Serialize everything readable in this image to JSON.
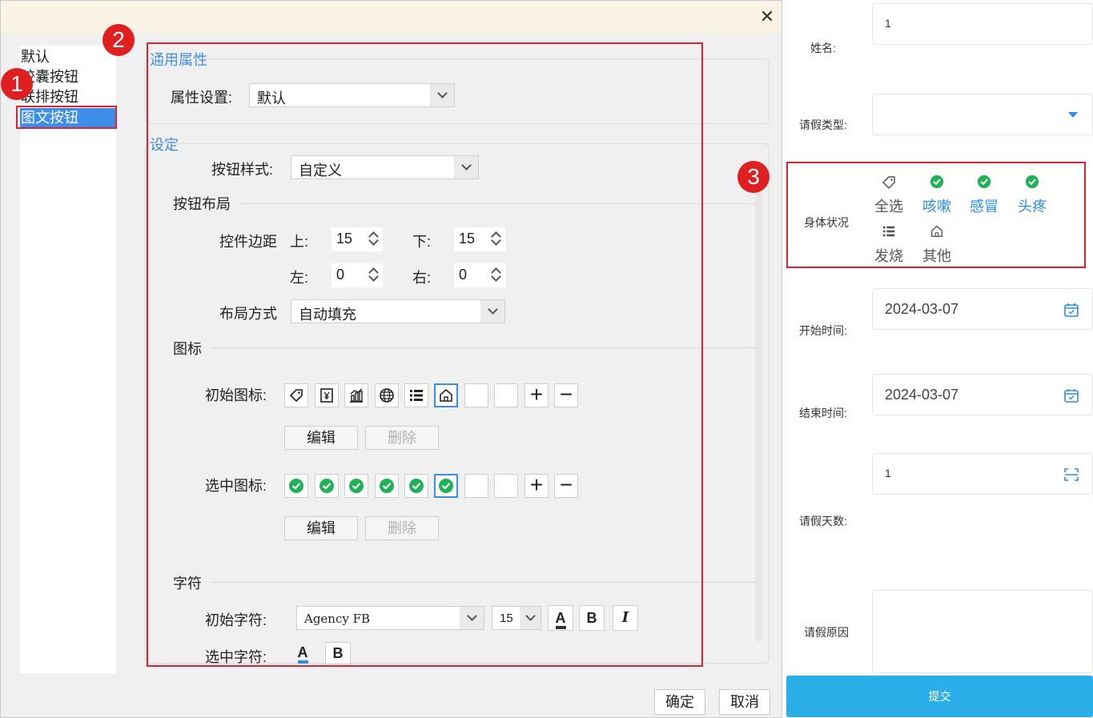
{
  "dialog": {
    "close_glyph": "✕",
    "type_list": [
      "默认",
      "胶囊按钮",
      "联排按钮",
      "图文按钮"
    ],
    "selected_type": "图文按钮",
    "general": {
      "title": "通用属性",
      "property_label": "属性设置:",
      "property_value": "默认"
    },
    "settings": {
      "title": "设定",
      "style_label": "按钮样式:",
      "style_value": "自定义",
      "layout_title": "按钮布局",
      "margin_label": "控件边距",
      "top_label": "上:",
      "top_value": "15",
      "bottom_label": "下:",
      "bottom_value": "15",
      "left_label": "左:",
      "left_value": "0",
      "right_label": "右:",
      "right_value": "0",
      "mode_label": "布局方式",
      "mode_value": "自动填充"
    },
    "icons": {
      "title": "图标",
      "initial_label": "初始图标:",
      "initial_icons": [
        "tag-icon",
        "yen-icon",
        "chart-icon",
        "globe-icon",
        "list-icon",
        "home-icon"
      ],
      "selected_label": "选中图标:",
      "selected_icons": [
        "check-icon",
        "check-icon",
        "check-icon",
        "check-icon",
        "check-icon",
        "check-icon"
      ],
      "add": "+",
      "remove": "−",
      "edit_label": "编辑",
      "delete_label": "删除"
    },
    "chars": {
      "title": "字符",
      "initial_label": "初始字符:",
      "font_value": "Agency FB",
      "size_value": "15",
      "selected_label": "选中字符:",
      "color_glyph": "A",
      "bold_glyph": "B",
      "italic_glyph": "I"
    },
    "ok_label": "确定",
    "cancel_label": "取消"
  },
  "callouts": [
    "1",
    "2",
    "3"
  ],
  "preview": {
    "name_label": "姓名:",
    "name_value": "1",
    "leave_type_label": "请假类型:",
    "health_label": "身体状况",
    "options": [
      {
        "label": "全选",
        "icon": "tag-icon",
        "selected": false
      },
      {
        "label": "咳嗽",
        "icon": "check-icon",
        "selected": true
      },
      {
        "label": "感冒",
        "icon": "check-icon",
        "selected": true
      },
      {
        "label": "头疼",
        "icon": "check-icon",
        "selected": true
      },
      {
        "label": "发烧",
        "icon": "list-icon",
        "selected": false
      },
      {
        "label": "其他",
        "icon": "home-icon",
        "selected": false
      }
    ],
    "start_label": "开始时间:",
    "start_value": "2024-03-07",
    "end_label": "结束时间:",
    "end_value": "2024-03-07",
    "days_label": "请假天数:",
    "days_value": "1",
    "reason_label": "请假原因",
    "submit_label": "提交",
    "accent": "#2aaee8"
  }
}
